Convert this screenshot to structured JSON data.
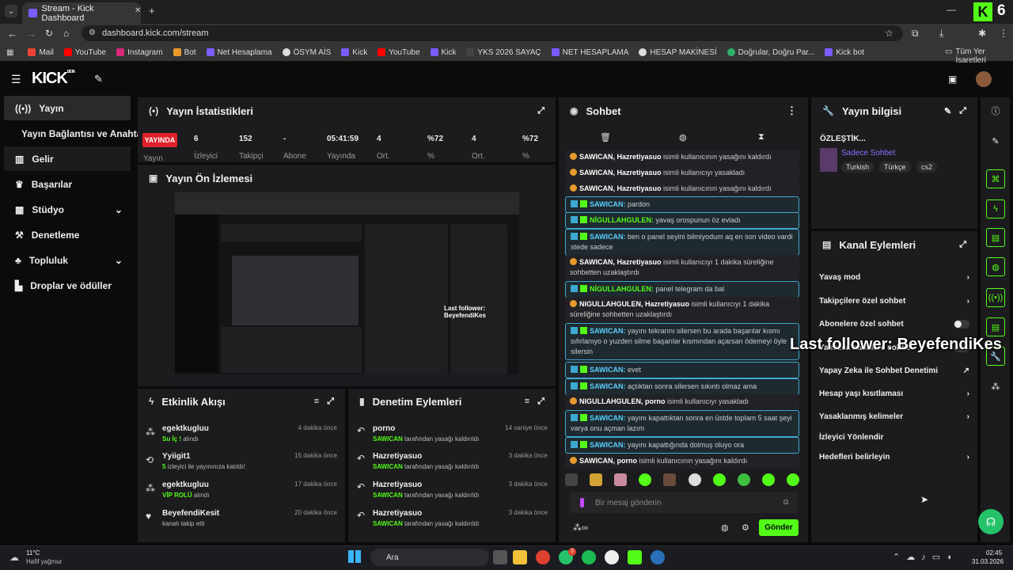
{
  "browser": {
    "tab_title": "Stream - Kick Dashboard",
    "url": "dashboard.kick.com/stream",
    "bookmarks": [
      "Mail",
      "YouTube",
      "Instagram",
      "Bot",
      "Net Hesaplama",
      "ÖSYM AİS",
      "Kick",
      "YouTube",
      "Kick",
      "YKS 2026 SAYAÇ",
      "NET HESAPLAMA",
      "HESAP MAKİNESİ",
      "Doğrular, Doğru Par...",
      "Kick bot"
    ],
    "all_bookmarks": "Tüm Yer İşaretleri",
    "corner_badge": "6"
  },
  "app": {
    "logo": "KICK",
    "logo_beta": "BETA"
  },
  "sidebar": {
    "items": [
      "Yayın",
      "Yayın Bağlantısı ve Anahtarı",
      "Gelir",
      "Başarılar",
      "Stüdyo",
      "Denetleme",
      "Topluluk",
      "Droplar ve ödüller"
    ]
  },
  "stats": {
    "title": "Yayın İstatistikleri",
    "live_badge": "YAYINDA",
    "live_label": "Yayın",
    "items": [
      {
        "value": "6",
        "label": "İzleyici"
      },
      {
        "value": "152",
        "label": "Takipçi"
      },
      {
        "value": "-",
        "label": "Abone"
      },
      {
        "value": "05:41:59",
        "label": "Yayında"
      },
      {
        "value": "4",
        "label": "Ort."
      },
      {
        "value": "%72",
        "label": "%"
      },
      {
        "value": "4",
        "label": "Ort."
      },
      {
        "value": "%72",
        "label": "%"
      }
    ]
  },
  "preview": {
    "title": "Yayın Ön İzlemesi",
    "overlay_text": "Last follower: BeyefendiKes"
  },
  "activity": {
    "title": "Etkinlik Akışı",
    "items": [
      {
        "name": "egektkugluu",
        "highlight": "Su İç !",
        "rest": "alındı",
        "time": "4 dakika önce"
      },
      {
        "name": "Yyiigit1",
        "highlight": "5",
        "rest": "izleyici ile yayınınıza katıldı!",
        "time": "15 dakika önce"
      },
      {
        "name": "egektkugluu",
        "highlight": "VİP ROLÜ",
        "rest": "alındı",
        "time": "17 dakika önce"
      },
      {
        "name": "BeyefendiKesit",
        "highlight": "",
        "rest": "kanalı takip etti",
        "time": "20 dakika önce"
      }
    ]
  },
  "moderation": {
    "title": "Denetim Eylemleri",
    "items": [
      {
        "name": "porno",
        "by": "SAWICAN",
        "rest": "tarafından yasağı kaldırıldı",
        "time": "14 saniye önce"
      },
      {
        "name": "Hazretiyasuo",
        "by": "SAWICAN",
        "rest": "tarafından yasağı kaldırıldı",
        "time": "3 dakika önce"
      },
      {
        "name": "Hazretiyasuo",
        "by": "SAWICAN",
        "rest": "tarafından yasağı kaldırıldı",
        "time": "3 dakika önce"
      },
      {
        "name": "Hazretiyasuo",
        "by": "SAWICAN",
        "rest": "tarafından yasağı kaldırıldı",
        "time": "3 dakika önce"
      }
    ]
  },
  "chat": {
    "title": "Sohbet",
    "placeholder": "Bir mesaj gönderin",
    "send": "Gönder",
    "messages": [
      {
        "type": "sys",
        "user": "SAWICAN, Hazretiyasuo",
        "text": "isimli kullanıcının yasağını kaldırdı"
      },
      {
        "type": "sys",
        "user": "SAWICAN, Hazretiyasuo",
        "text": "isimli kullanıcıyı yasakladı"
      },
      {
        "type": "sys",
        "user": "SAWICAN, Hazretiyasuo",
        "text": "isimli kullanıcının yasağını kaldırdı"
      },
      {
        "type": "mod",
        "user": "SAWICAN:",
        "text": "pardon"
      },
      {
        "type": "grn",
        "user": "NİGULLAHGULEN:",
        "text": "yavaş orospunun öz evladı"
      },
      {
        "type": "mod",
        "user": "SAWICAN:",
        "text": "ben o panel seyini bilmiyodum aq en son video vardi stede sadece"
      },
      {
        "type": "sys",
        "user": "SAWICAN, Hazretiyasuo",
        "text": "isimli kullanıcıyı 1 dakika süreliğine sohbetten uzaklaştırdı"
      },
      {
        "type": "grn",
        "user": "NİGULLAHGULEN:",
        "text": "panel telegram da bal"
      },
      {
        "type": "sys",
        "user": "NIGULLAHGULEN, Hazretiyasuo",
        "text": "isimli kullanıcıyı 1 dakika süreliğine sohbetten uzaklaştırdı"
      },
      {
        "type": "mod",
        "user": "SAWICAN:",
        "text": "yayını tekrarını silersen bu arada başarılar kısmı sıfırlanıyo o yuzden silme başarılar kısmından açarsan ödemeyi öyle silersin"
      },
      {
        "type": "mod",
        "user": "SAWICAN:",
        "text": "evet"
      },
      {
        "type": "mod",
        "user": "SAWICAN:",
        "text": "açtıktan sonra silersen sıkıntı olmaz ama"
      },
      {
        "type": "sys",
        "user": "NIGULLAHGULEN, porno",
        "text": "isimli kullanıcıyı yasakladı"
      },
      {
        "type": "mod",
        "user": "SAWICAN:",
        "text": "yayını kapattıktan sonra en üstde toplam 5 saat şeyi varya onu açman lazım"
      },
      {
        "type": "mod",
        "user": "SAWICAN:",
        "text": "yayını kapattığında dolmuş oluyo ora"
      },
      {
        "type": "sys",
        "user": "SAWICAN, porno",
        "text": "isimli kullanıcının yasağını kaldırdı"
      }
    ]
  },
  "stream_info": {
    "title": "Yayın bilgisi",
    "stream_title": "ÖZLEŞTİK...",
    "category": "Sadece Sohbet",
    "tags": [
      "Turkish",
      "Türkçe",
      "cs2"
    ]
  },
  "channel_actions": {
    "title": "Kanal Eylemleri",
    "items": [
      "Yavaş mod",
      "Takipçilere özel sohbet",
      "Abonelere özel sohbet",
      "Yalnızca hadelere sohbet",
      "Yapay Zeka ile Sohbet Denetimi",
      "Hesap yaşı kısıtlaması",
      "Yasaklanmış kelimeler",
      "İzleyici Yönlendir",
      "Hedefleri belirleyin"
    ]
  },
  "overlay": {
    "text": "Last follower: BeyefendiKes"
  },
  "taskbar": {
    "weather_temp": "11°C",
    "weather_desc": "Hafif yağmur",
    "search": "Ara",
    "time": "02:45",
    "date": "31.03.2026",
    "notif_count": "3"
  },
  "colors": {
    "accent": "#53fc18",
    "panel": "#1c1c1e",
    "background": "#0b0b0c",
    "live": "#e0202a"
  }
}
